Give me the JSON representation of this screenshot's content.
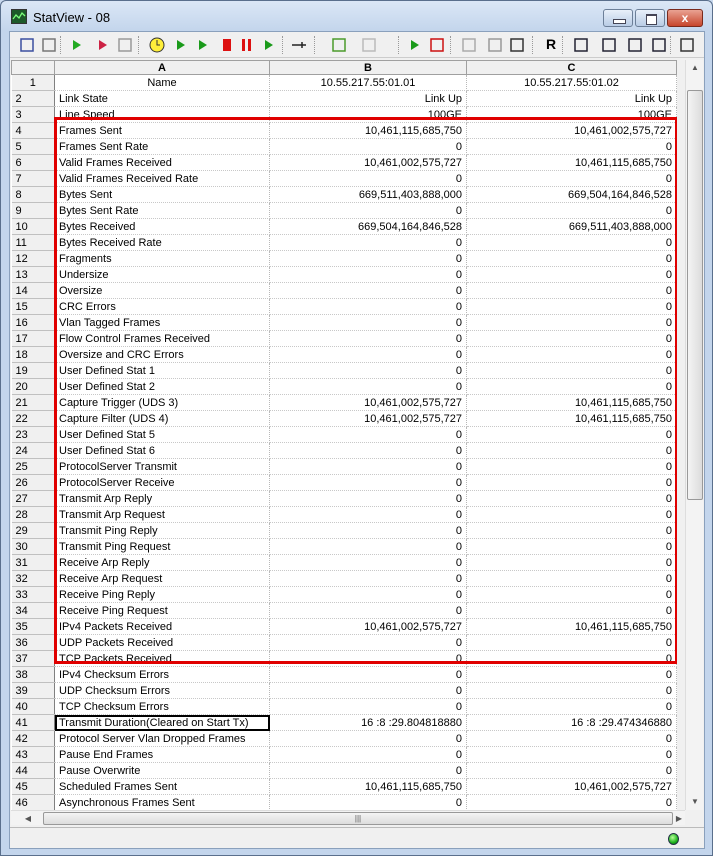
{
  "window": {
    "title": "StatView - 08",
    "close_label": "x"
  },
  "toolbar": {
    "icons": [
      "clear-stats-icon",
      "erase-icon",
      "start-capture-icon",
      "start-icon",
      "binoculars-icon",
      "clock-icon",
      "play-icon",
      "fast-forward-icon",
      "stop-icon",
      "pause-icon",
      "step-icon",
      "add-row-icon",
      "columns-icon",
      "grayed-icon",
      "port-start-icon",
      "port-stop-icon",
      "list-icon",
      "properties-icon",
      "properties-edit-icon",
      "r-icon",
      "connect-icon",
      "split-icon",
      "merge-icon",
      "insert-icon",
      "settings-icon"
    ],
    "r_label": "R"
  },
  "grid": {
    "columns": [
      "A",
      "B",
      "C"
    ],
    "rows": [
      [
        "1",
        "Name",
        "10.55.217.55:01.01",
        "10.55.217.55:01.02"
      ],
      [
        "2",
        "Link State",
        "Link Up",
        "Link Up"
      ],
      [
        "3",
        "Line Speed",
        "100GE",
        "100GE"
      ],
      [
        "4",
        "Frames Sent",
        "10,461,115,685,750",
        "10,461,002,575,727"
      ],
      [
        "5",
        "Frames Sent Rate",
        "0",
        "0"
      ],
      [
        "6",
        "Valid Frames Received",
        "10,461,002,575,727",
        "10,461,115,685,750"
      ],
      [
        "7",
        "Valid Frames Received Rate",
        "0",
        "0"
      ],
      [
        "8",
        "Bytes Sent",
        "669,511,403,888,000",
        "669,504,164,846,528"
      ],
      [
        "9",
        "Bytes Sent Rate",
        "0",
        "0"
      ],
      [
        "10",
        "Bytes Received",
        "669,504,164,846,528",
        "669,511,403,888,000"
      ],
      [
        "11",
        "Bytes Received Rate",
        "0",
        "0"
      ],
      [
        "12",
        "Fragments",
        "0",
        "0"
      ],
      [
        "13",
        "Undersize",
        "0",
        "0"
      ],
      [
        "14",
        "Oversize",
        "0",
        "0"
      ],
      [
        "15",
        "CRC Errors",
        "0",
        "0"
      ],
      [
        "16",
        "Vlan Tagged Frames",
        "0",
        "0"
      ],
      [
        "17",
        "Flow Control Frames Received",
        "0",
        "0"
      ],
      [
        "18",
        "Oversize and CRC Errors",
        "0",
        "0"
      ],
      [
        "19",
        "User Defined Stat 1",
        "0",
        "0"
      ],
      [
        "20",
        "User Defined Stat 2",
        "0",
        "0"
      ],
      [
        "21",
        "Capture Trigger (UDS 3)",
        "10,461,002,575,727",
        "10,461,115,685,750"
      ],
      [
        "22",
        "Capture Filter (UDS 4)",
        "10,461,002,575,727",
        "10,461,115,685,750"
      ],
      [
        "23",
        "User Defined Stat 5",
        "0",
        "0"
      ],
      [
        "24",
        "User Defined Stat 6",
        "0",
        "0"
      ],
      [
        "25",
        "ProtocolServer Transmit",
        "0",
        "0"
      ],
      [
        "26",
        "ProtocolServer Receive",
        "0",
        "0"
      ],
      [
        "27",
        "Transmit Arp Reply",
        "0",
        "0"
      ],
      [
        "28",
        "Transmit Arp Request",
        "0",
        "0"
      ],
      [
        "29",
        "Transmit Ping Reply",
        "0",
        "0"
      ],
      [
        "30",
        "Transmit Ping Request",
        "0",
        "0"
      ],
      [
        "31",
        "Receive Arp Reply",
        "0",
        "0"
      ],
      [
        "32",
        "Receive Arp Request",
        "0",
        "0"
      ],
      [
        "33",
        "Receive Ping Reply",
        "0",
        "0"
      ],
      [
        "34",
        "Receive Ping Request",
        "0",
        "0"
      ],
      [
        "35",
        "IPv4 Packets Received",
        "10,461,002,575,727",
        "10,461,115,685,750"
      ],
      [
        "36",
        "UDP Packets Received",
        "0",
        "0"
      ],
      [
        "37",
        "TCP Packets Received",
        "0",
        "0"
      ],
      [
        "38",
        "IPv4 Checksum Errors",
        "0",
        "0"
      ],
      [
        "39",
        "UDP Checksum Errors",
        "0",
        "0"
      ],
      [
        "40",
        "TCP Checksum Errors",
        "0",
        "0"
      ],
      [
        "41",
        "Transmit Duration(Cleared on Start Tx)",
        "16 :8 :29.804818880",
        "16 :8 :29.474346880"
      ],
      [
        "42",
        "Protocol Server Vlan Dropped Frames",
        "0",
        "0"
      ],
      [
        "43",
        "Pause End Frames",
        "0",
        "0"
      ],
      [
        "44",
        "Pause Overwrite",
        "0",
        "0"
      ],
      [
        "45",
        "Scheduled Frames Sent",
        "10,461,115,685,750",
        "10,461,002,575,727"
      ],
      [
        "46",
        "Asynchronous Frames Sent",
        "0",
        "0"
      ]
    ],
    "selected_row": "41",
    "highlight_color": "#e00000"
  },
  "statusbar": {
    "led_color": "#1db31d"
  }
}
